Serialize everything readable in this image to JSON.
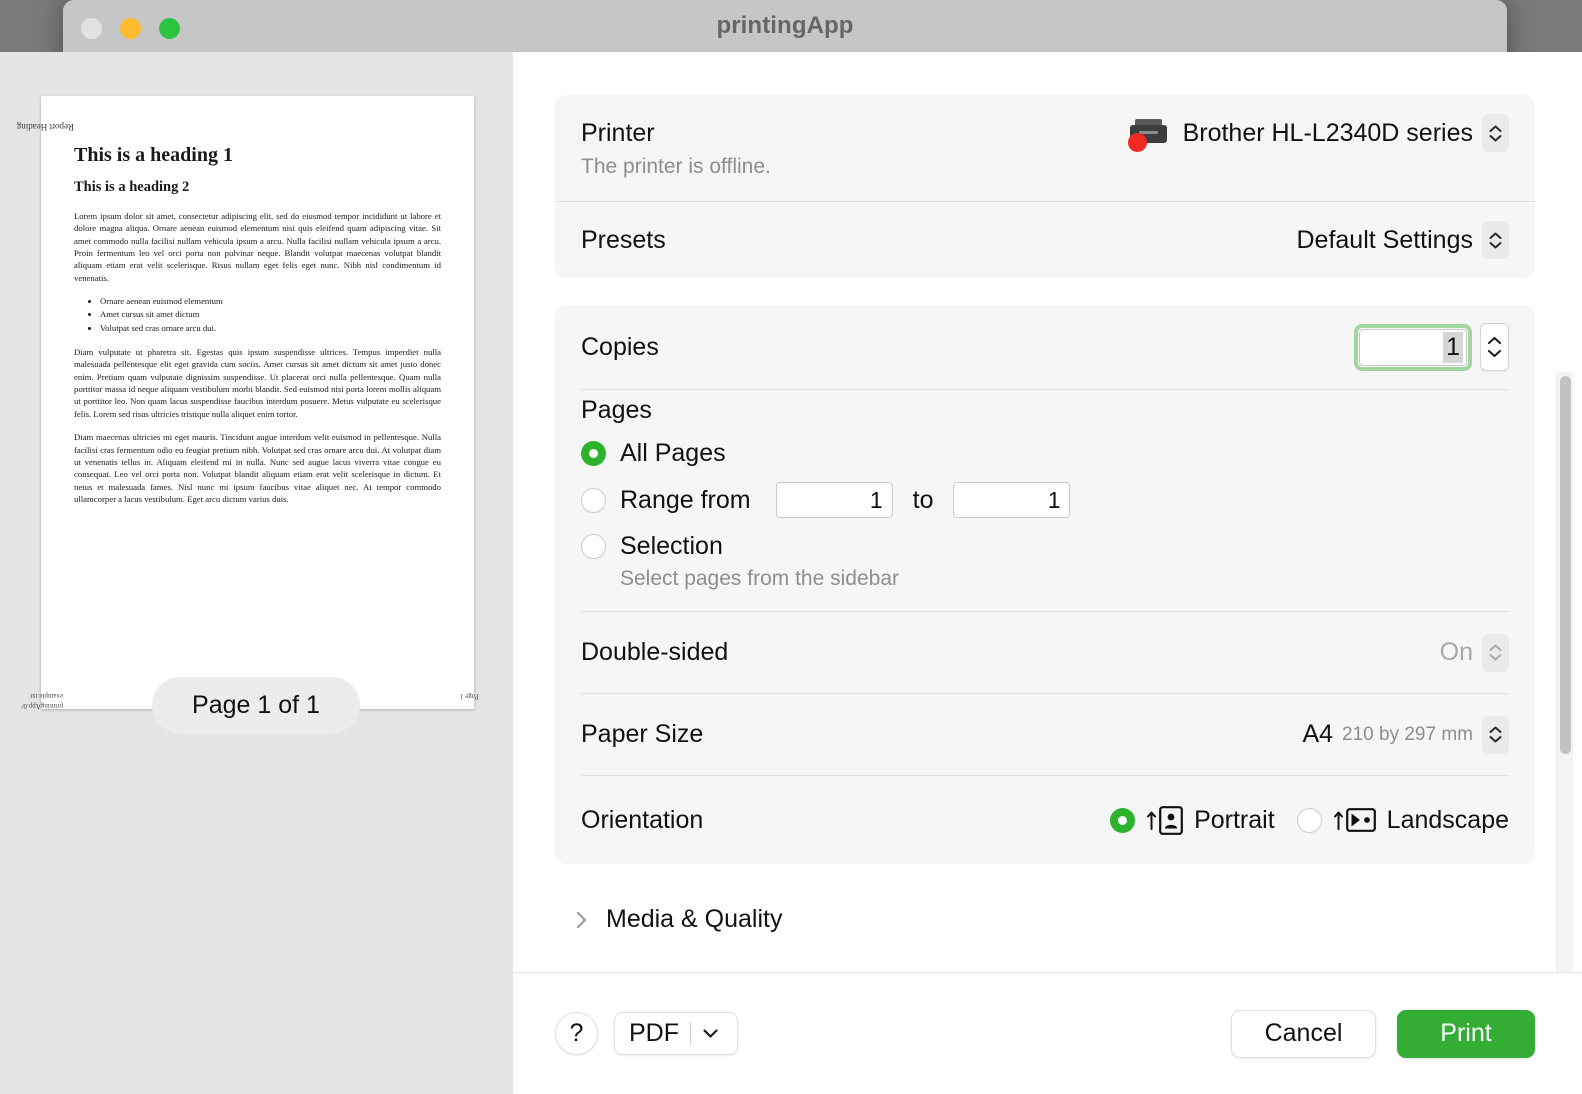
{
  "window": {
    "title": "printingApp",
    "traffic_lights": [
      "close",
      "minimize",
      "maximize"
    ]
  },
  "preview": {
    "document": {
      "header_flipped": "Report Heading",
      "heading1": "This is a heading 1",
      "heading2": "This is a heading 2",
      "paragraph1": "Lorem ipsum dolor sit amet, consectetur adipiscing elit, sed do eiusmod tempor incididunt ut labore et dolore magna aliqua. Ornare aenean euismod elementum nisi quis eleifend quam adipiscing vitae. Sit amet commodo nulla facilisi nullam vehicula ipsum a arcu. Nulla facilisi nullam vehicula ipsum a arcu. Proin fermentum leo vel orci porta non pulvinar neque. Blandit volutpat maecenas volutpat blandit aliquam etiam erat velit scelerisque. Risus nullam eget felis eget nunc. Nibh nisl condimentum id venenatis.",
      "bullets": [
        "Ornare aenean euismod elementum",
        "Amet cursus sit amet dictum",
        "Volutpat sed cras ornare arcu dui."
      ],
      "paragraph2": "Diam vulputate ut pharetra sit. Egestas quis ipsum suspendisse ultrices. Tempus imperdiet nulla malesuada pellentesque elit eget gravida cum sociis. Amet cursus sit amet dictum sit amet justo donec enim. Pretium quam vulputate dignissim suspendisse. Ut placerat orci nulla pellentesque. Quam nulla porttitor massa id neque aliquam vestibulum morbi blandit. Sed euismod nisi porta lorem mollis aliquam ut porttitor leo. Non quam lacus suspendisse faucibus interdum posuere. Metus vulputate eu scelerisque felis. Lorem sed risus ultricies tristique nulla aliquet enim tortor.",
      "paragraph3": "Diam maecenas ultricies mi eget mauris. Tincidunt augue interdum velit euismod in pellentesque. Nulla facilisi cras fermentum odio eu feugiat pretium nibh. Volutpat sed cras ornare arcu dui. At volutpat diam ut venenatis tellus in. Aliquam eleifend mi in nulla. Nunc sed augue lacus viverra vitae congue eu consequat. Leo vel orci porta non. Volutpat blandit aliquam etiam erat velit scelerisque in dictum. Et netus et malesuada fames. Nisl nunc mi ipsum faucibus vitae aliquet nec. At tempor commodo ullamcorper a lacus vestibulum. Eget arcu dictum varius duis.",
      "footer_left_line1": "printingApp.0/",
      "footer_left_line2": "example.txt",
      "footer_right": "Page 1"
    },
    "page_indicator": "Page 1 of 1"
  },
  "options": {
    "printer": {
      "label": "Printer",
      "value": "Brother HL-L2340D series",
      "status": "The printer is offline.",
      "icon": "printer-icon",
      "status_badge_color": "#f02a22"
    },
    "presets": {
      "label": "Presets",
      "value": "Default Settings"
    },
    "copies": {
      "label": "Copies",
      "value": "1",
      "focus_ring_color": "#9fd79c"
    },
    "pages": {
      "label": "Pages",
      "all_pages_label": "All Pages",
      "range_label": "Range from",
      "range_from": "1",
      "to_label": "to",
      "range_to": "1",
      "selection_label": "Selection",
      "selection_note": "Select pages from the sidebar",
      "selected": "all_pages"
    },
    "double_sided": {
      "label": "Double-sided",
      "value": "On"
    },
    "paper_size": {
      "label": "Paper Size",
      "value": "A4",
      "dimensions": "210 by 297 mm"
    },
    "orientation": {
      "label": "Orientation",
      "portrait_label": "Portrait",
      "landscape_label": "Landscape",
      "selected": "portrait"
    },
    "media_quality": {
      "label": "Media & Quality",
      "expanded": false
    }
  },
  "footer": {
    "help_label": "?",
    "pdf_label": "PDF",
    "cancel_label": "Cancel",
    "print_label": "Print",
    "print_button_color": "#33ad33"
  }
}
